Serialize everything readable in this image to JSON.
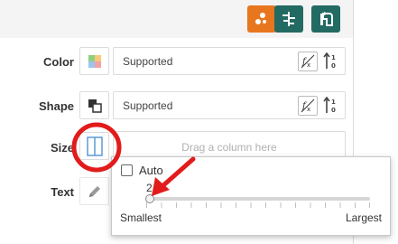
{
  "toolbar": {
    "buttons": [
      {
        "icon": "scatter-dots-icon",
        "color": "#E8761E"
      },
      {
        "icon": "align-bars-icon",
        "color": "#236A62"
      },
      {
        "icon": "pivot-swap-icon",
        "color": "#236A62"
      }
    ]
  },
  "rows": {
    "color": {
      "label": "Color",
      "value": "Supported"
    },
    "shape": {
      "label": "Shape",
      "value": "Supported"
    },
    "size": {
      "label": "Size",
      "placeholder": "Drag a column here"
    },
    "text": {
      "label": "Text"
    }
  },
  "size_popup": {
    "auto_label": "Auto",
    "auto_checked": false,
    "slider_value": "2",
    "slider_position_fraction": 0.0,
    "min_label": "Smallest",
    "max_label": "Largest"
  },
  "annotations": {
    "highlight_color": "#E21B1B"
  }
}
